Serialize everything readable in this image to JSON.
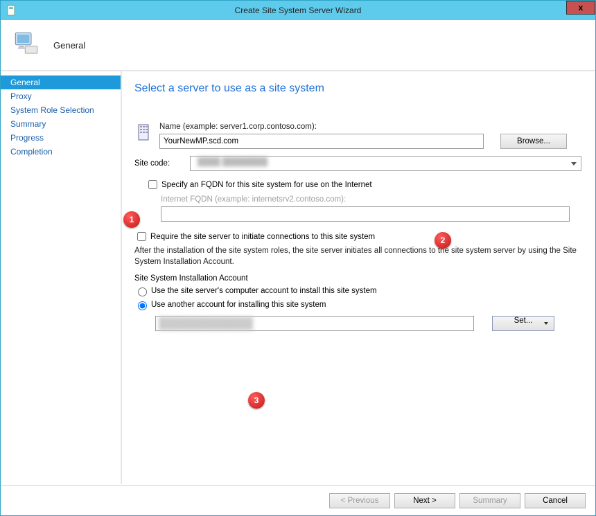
{
  "titlebar": {
    "title": "Create Site System Server Wizard",
    "close": "x"
  },
  "header": {
    "step": "General"
  },
  "sidebar": {
    "items": [
      {
        "label": "General",
        "active": true
      },
      {
        "label": "Proxy"
      },
      {
        "label": "System Role Selection"
      },
      {
        "label": "Summary"
      },
      {
        "label": "Progress"
      },
      {
        "label": "Completion"
      }
    ]
  },
  "page": {
    "heading": "Select a server to use as a site system",
    "name_label": "Name (example: server1.corp.contoso.com):",
    "name_value": "YourNewMP.scd.com",
    "browse": "Browse...",
    "sitecode_label": "Site code:",
    "fqdn_check": "Specify an FQDN for this site system for use on the Internet",
    "fqdn_sublabel": "Internet FQDN (example: internetsrv2.contoso.com):",
    "require_check": "Require the site server to initiate connections to this site system",
    "info_text": "After the  installation of the site system roles, the site server initiates all connections to the site system server by using the Site System Installation Account.",
    "account_section": "Site System Installation Account",
    "radio_server": "Use the site server's computer account to install this site system",
    "radio_other": "Use another account for installing this site system",
    "set": "Set..."
  },
  "footer": {
    "previous": "< Previous",
    "next": "Next >",
    "summary": "Summary",
    "cancel": "Cancel"
  },
  "annotations": {
    "a1": "1",
    "a2": "2",
    "a3": "3"
  }
}
